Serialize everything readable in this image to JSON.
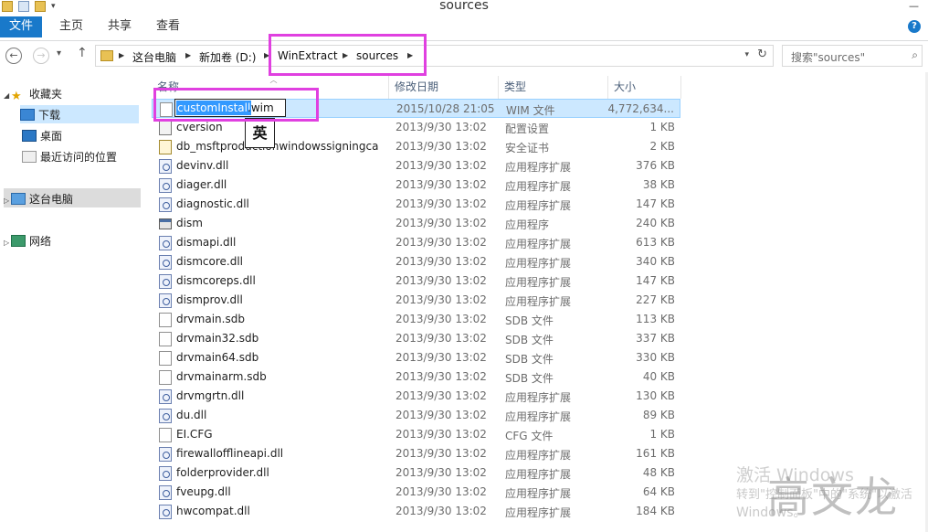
{
  "window": {
    "title": "sources"
  },
  "ribbon": {
    "file": "文件",
    "tabs": [
      "主页",
      "共享",
      "查看"
    ]
  },
  "address": {
    "crumbs": [
      "这台电脑",
      "新加卷 (D:)",
      "WinExtract",
      "sources"
    ]
  },
  "search": {
    "placeholder": "搜索\"sources\""
  },
  "nav": {
    "favorites": "收藏夹",
    "downloads": "下载",
    "desktop": "桌面",
    "recent": "最近访问的位置",
    "this_pc": "这台电脑",
    "network": "网络"
  },
  "columns": {
    "name": "名称",
    "date": "修改日期",
    "type": "类型",
    "size": "大小"
  },
  "rename": {
    "selected": "customInstall",
    "rest": ".wim",
    "ime": "英"
  },
  "files": [
    {
      "name": "customInstall.wim",
      "date": "2015/10/28 21:05",
      "type": "WIM 文件",
      "size": "4,772,634...",
      "icon": "blank"
    },
    {
      "name": "cversion",
      "date": "2013/9/30 13:02",
      "type": "配置设置",
      "size": "1 KB",
      "icon": "cfg"
    },
    {
      "name": "db_msftproductionwindowssigningca",
      "date": "2013/9/30 13:02",
      "type": "安全证书",
      "size": "2 KB",
      "icon": "cat"
    },
    {
      "name": "devinv.dll",
      "date": "2013/9/30 13:02",
      "type": "应用程序扩展",
      "size": "376 KB",
      "icon": "dll"
    },
    {
      "name": "diager.dll",
      "date": "2013/9/30 13:02",
      "type": "应用程序扩展",
      "size": "38 KB",
      "icon": "dll"
    },
    {
      "name": "diagnostic.dll",
      "date": "2013/9/30 13:02",
      "type": "应用程序扩展",
      "size": "147 KB",
      "icon": "dll"
    },
    {
      "name": "dism",
      "date": "2013/9/30 13:02",
      "type": "应用程序",
      "size": "240 KB",
      "icon": "exe"
    },
    {
      "name": "dismapi.dll",
      "date": "2013/9/30 13:02",
      "type": "应用程序扩展",
      "size": "613 KB",
      "icon": "dll"
    },
    {
      "name": "dismcore.dll",
      "date": "2013/9/30 13:02",
      "type": "应用程序扩展",
      "size": "340 KB",
      "icon": "dll"
    },
    {
      "name": "dismcoreps.dll",
      "date": "2013/9/30 13:02",
      "type": "应用程序扩展",
      "size": "147 KB",
      "icon": "dll"
    },
    {
      "name": "dismprov.dll",
      "date": "2013/9/30 13:02",
      "type": "应用程序扩展",
      "size": "227 KB",
      "icon": "dll"
    },
    {
      "name": "drvmain.sdb",
      "date": "2013/9/30 13:02",
      "type": "SDB 文件",
      "size": "113 KB",
      "icon": "blank"
    },
    {
      "name": "drvmain32.sdb",
      "date": "2013/9/30 13:02",
      "type": "SDB 文件",
      "size": "337 KB",
      "icon": "blank"
    },
    {
      "name": "drvmain64.sdb",
      "date": "2013/9/30 13:02",
      "type": "SDB 文件",
      "size": "330 KB",
      "icon": "blank"
    },
    {
      "name": "drvmainarm.sdb",
      "date": "2013/9/30 13:02",
      "type": "SDB 文件",
      "size": "40 KB",
      "icon": "blank"
    },
    {
      "name": "drvmgrtn.dll",
      "date": "2013/9/30 13:02",
      "type": "应用程序扩展",
      "size": "130 KB",
      "icon": "dll"
    },
    {
      "name": "du.dll",
      "date": "2013/9/30 13:02",
      "type": "应用程序扩展",
      "size": "89 KB",
      "icon": "dll"
    },
    {
      "name": "EI.CFG",
      "date": "2013/9/30 13:02",
      "type": "CFG 文件",
      "size": "1 KB",
      "icon": "blank"
    },
    {
      "name": "firewallofflineapi.dll",
      "date": "2013/9/30 13:02",
      "type": "应用程序扩展",
      "size": "161 KB",
      "icon": "dll"
    },
    {
      "name": "folderprovider.dll",
      "date": "2013/9/30 13:02",
      "type": "应用程序扩展",
      "size": "48 KB",
      "icon": "dll"
    },
    {
      "name": "fveupg.dll",
      "date": "2013/9/30 13:02",
      "type": "应用程序扩展",
      "size": "64 KB",
      "icon": "dll"
    },
    {
      "name": "hwcompat.dll",
      "date": "2013/9/30 13:02",
      "type": "应用程序扩展",
      "size": "184 KB",
      "icon": "dll"
    }
  ],
  "watermark": {
    "line1": "激活 Windows",
    "line2": "转到\"控制面板\"中的\"系统\"以激活",
    "line3": "Windows。",
    "signature": "高文龙"
  }
}
